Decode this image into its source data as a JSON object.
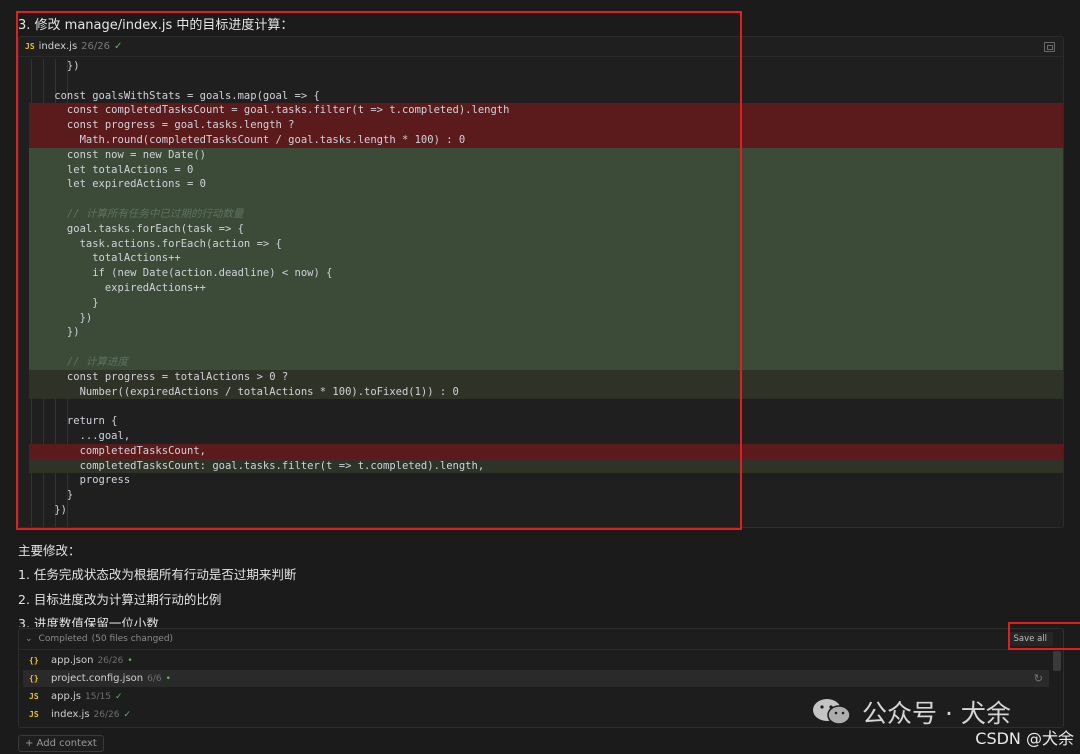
{
  "heading": "3. 修改 manage/index.js 中的目标进度计算：",
  "code_card": {
    "badge": "JS",
    "file_name": "index.js",
    "count": "26/26",
    "check": "✓",
    "lines": [
      {
        "text": "      })",
        "status": "none"
      },
      {
        "text": "",
        "status": "none"
      },
      {
        "text": "    const goalsWithStats = goals.map(goal => {",
        "status": "none"
      },
      {
        "text": "      const completedTasksCount = goal.tasks.filter(t => t.completed).length",
        "status": "removed"
      },
      {
        "text": "      const progress = goal.tasks.length ?",
        "status": "removed"
      },
      {
        "text": "        Math.round(completedTasksCount / goal.tasks.length * 100) : 0",
        "status": "removed"
      },
      {
        "text": "      const now = new Date()",
        "status": "added"
      },
      {
        "text": "      let totalActions = 0",
        "status": "added"
      },
      {
        "text": "      let expiredActions = 0",
        "status": "added"
      },
      {
        "text": "",
        "status": "added"
      },
      {
        "text": "      // 计算所有任务中已过期的行动数量",
        "status": "added-comment"
      },
      {
        "text": "      goal.tasks.forEach(task => {",
        "status": "added"
      },
      {
        "text": "        task.actions.forEach(action => {",
        "status": "added"
      },
      {
        "text": "          totalActions++",
        "status": "added"
      },
      {
        "text": "          if (new Date(action.deadline) < now) {",
        "status": "added"
      },
      {
        "text": "            expiredActions++",
        "status": "added"
      },
      {
        "text": "          }",
        "status": "added"
      },
      {
        "text": "        })",
        "status": "added"
      },
      {
        "text": "      })",
        "status": "added"
      },
      {
        "text": "",
        "status": "added"
      },
      {
        "text": "      // 计算进度",
        "status": "added-comment"
      },
      {
        "text": "      const progress = totalActions > 0 ?",
        "status": "changed"
      },
      {
        "text": "        Number((expiredActions / totalActions * 100).toFixed(1)) : 0",
        "status": "changed"
      },
      {
        "text": "",
        "status": "none"
      },
      {
        "text": "      return {",
        "status": "none"
      },
      {
        "text": "        ...goal,",
        "status": "none"
      },
      {
        "text": "        completedTasksCount,",
        "status": "removed"
      },
      {
        "text": "        completedTasksCount: goal.tasks.filter(t => t.completed).length,",
        "status": "changed"
      },
      {
        "text": "        progress",
        "status": "none"
      },
      {
        "text": "      }",
        "status": "none"
      },
      {
        "text": "    })",
        "status": "none"
      }
    ]
  },
  "summary": {
    "title": "主要修改：",
    "items": [
      "1. 任务完成状态改为根据所有行动是否过期来判断",
      "2. 目标进度改为计算过期行动的比例",
      "3. 进度数值保留一位小数"
    ]
  },
  "files_panel": {
    "header": "Completed",
    "changed": "(50 files changed)",
    "save_all": "Save all",
    "files": [
      {
        "icon": "{}",
        "name": "app.json",
        "count": "26/26",
        "mark": "•",
        "selected": false
      },
      {
        "icon": "{}",
        "name": "project.config.json",
        "count": "6/6",
        "mark": "•",
        "selected": true
      },
      {
        "icon": "JS",
        "name": "app.js",
        "count": "15/15",
        "mark": "✓",
        "selected": false
      },
      {
        "icon": "JS",
        "name": "index.js",
        "count": "26/26",
        "mark": "✓",
        "selected": false
      }
    ]
  },
  "add_context": "+ Add context",
  "watermark": {
    "text": "公众号 · 犬余",
    "site": "CSDN @犬余"
  },
  "colors": {
    "annotation_red": "#e02020",
    "removed": "#5b1a1c",
    "added": "#3c4a38"
  }
}
